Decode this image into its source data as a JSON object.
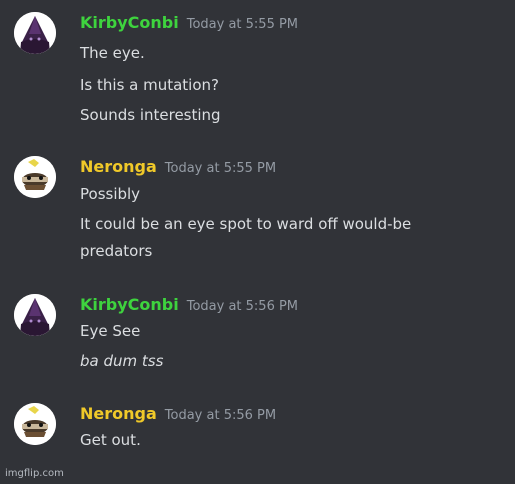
{
  "colors": {
    "background": "#313338",
    "username_kirby": "#3ed33e",
    "username_neronga": "#f0c929",
    "timestamp": "#949ba4",
    "message_text": "#dbdee1"
  },
  "messages": [
    {
      "avatar_icon": "purple-hooded-figure-avatar",
      "username": "KirbyConbi",
      "timestamp": "Today at 5:55 PM",
      "lines": [
        "The eye.",
        "Is this a mutation?",
        "Sounds interesting"
      ]
    },
    {
      "avatar_icon": "shrimp-creature-avatar",
      "username": "Neronga",
      "timestamp": "Today at 5:55 PM",
      "lines": [
        "Possibly",
        "It could be an eye spot to ward off would-be",
        "predators"
      ]
    },
    {
      "avatar_icon": "purple-hooded-figure-avatar",
      "username": "KirbyConbi",
      "timestamp": "Today at 5:56 PM",
      "lines": [
        "Eye See",
        "ba dum tss"
      ]
    },
    {
      "avatar_icon": "shrimp-creature-avatar",
      "username": "Neronga",
      "timestamp": "Today at 5:56 PM",
      "lines": [
        "Get out."
      ]
    }
  ],
  "watermark": "imgflip.com"
}
